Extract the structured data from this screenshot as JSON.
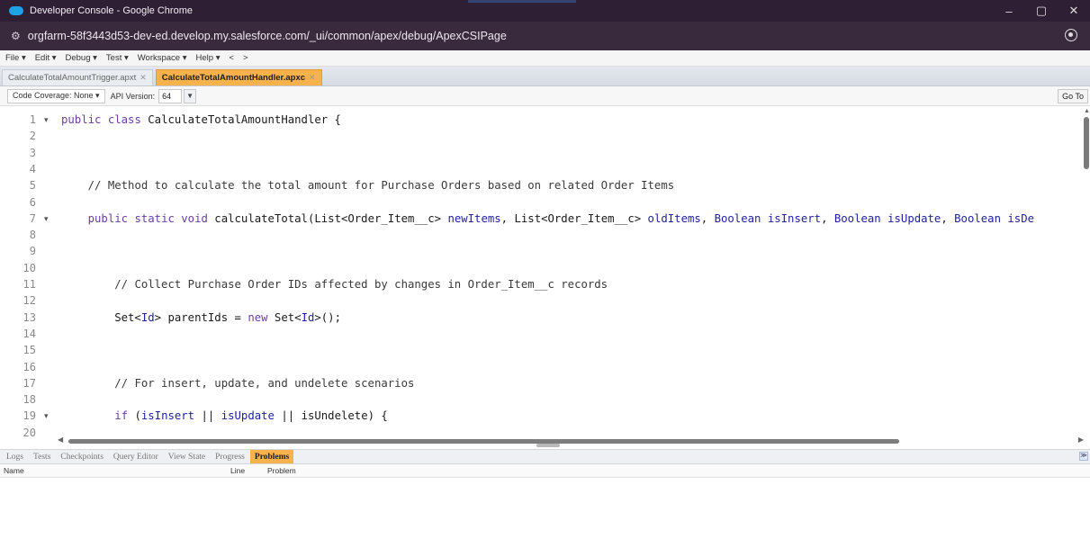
{
  "window": {
    "title": "Developer Console - Google Chrome",
    "minimize": "–",
    "maximize": "▢",
    "close": "✕"
  },
  "address": {
    "url": "orgfarm-58f3443d53-dev-ed.develop.my.salesforce.com/_ui/common/apex/debug/ApexCSIPage"
  },
  "menu": {
    "items": [
      "File ▾",
      "Edit ▾",
      "Debug ▾",
      "Test ▾",
      "Workspace ▾",
      "Help ▾",
      "<",
      ">"
    ]
  },
  "file_tabs": [
    {
      "label": "CalculateTotalAmountTrigger.apxt",
      "active": false
    },
    {
      "label": "CalculateTotalAmountHandler.apxc",
      "active": true
    }
  ],
  "toolbar": {
    "code_coverage": "Code Coverage: None ▾",
    "api_version_label": "API Version:",
    "api_version": "64",
    "go_to": "Go To"
  },
  "editor": {
    "lines": [
      {
        "n": "1",
        "fold": true,
        "code": "public class CalculateTotalAmountHandler {"
      },
      {
        "n": "2",
        "code": ""
      },
      {
        "n": "3",
        "code": ""
      },
      {
        "n": "4",
        "code": ""
      },
      {
        "n": "5",
        "code": "    // Method to calculate the total amount for Purchase Orders based on related Order Items"
      },
      {
        "n": "6",
        "code": ""
      },
      {
        "n": "7",
        "fold": true,
        "code": "    public static void calculateTotal(List<Order_Item__c> newItems, List<Order_Item__c> oldItems, Boolean isInsert, Boolean isUpdate, Boolean isDe"
      },
      {
        "n": "8",
        "code": ""
      },
      {
        "n": "9",
        "code": ""
      },
      {
        "n": "10",
        "code": ""
      },
      {
        "n": "11",
        "code": "        // Collect Purchase Order IDs affected by changes in Order_Item__c records"
      },
      {
        "n": "12",
        "code": ""
      },
      {
        "n": "13",
        "code": "        Set<Id> parentIds = new Set<Id>();"
      },
      {
        "n": "14",
        "code": ""
      },
      {
        "n": "15",
        "code": ""
      },
      {
        "n": "16",
        "code": ""
      },
      {
        "n": "17",
        "code": "        // For insert, update, and undelete scenarios"
      },
      {
        "n": "18",
        "code": ""
      },
      {
        "n": "19",
        "fold": true,
        "code": "        if (isInsert || isUpdate || isUndelete) {"
      },
      {
        "n": "20",
        "code": ""
      }
    ]
  },
  "bottom_tabs": [
    {
      "label": "Logs",
      "active": false
    },
    {
      "label": "Tests",
      "active": false
    },
    {
      "label": "Checkpoints",
      "active": false
    },
    {
      "label": "Query Editor",
      "active": false
    },
    {
      "label": "View State",
      "active": false
    },
    {
      "label": "Progress",
      "active": false
    },
    {
      "label": "Problems",
      "active": true
    }
  ],
  "problems_table": {
    "columns": [
      "Name",
      "Line",
      "Problem"
    ],
    "rows": []
  },
  "colors": {
    "title_bg": "#2f1f34",
    "address_bg": "#3a2a3e",
    "active_tab": "#f8b24b",
    "keyword": "#6b3fa0",
    "type": "#1f1f9e"
  }
}
